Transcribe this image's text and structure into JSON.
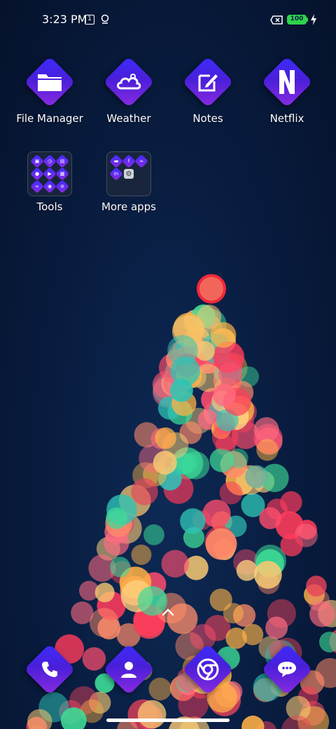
{
  "status_bar": {
    "time": "3:23 PM",
    "calendar_day": "1",
    "battery": "100",
    "icons": [
      "calendar-icon",
      "location-icon",
      "no-sim-icon",
      "battery-icon",
      "charging-bolt-icon"
    ]
  },
  "apps": [
    {
      "label": "File Manager",
      "icon": "folder-icon"
    },
    {
      "label": "Weather",
      "icon": "cloud-icon"
    },
    {
      "label": "Notes",
      "icon": "pencil-note-icon"
    },
    {
      "label": "Netflix",
      "icon": "netflix-n-icon"
    }
  ],
  "folders": [
    {
      "label": "Tools"
    },
    {
      "label": "More apps"
    }
  ],
  "dock": [
    {
      "icon": "phone-icon"
    },
    {
      "icon": "contacts-icon"
    },
    {
      "icon": "chrome-icon"
    },
    {
      "icon": "messages-icon"
    }
  ],
  "colors": {
    "background": "#0a1f44",
    "icon_gradient_start": "#3b2cff",
    "icon_gradient_end": "#8b2be0",
    "battery": "#2fd34a"
  }
}
